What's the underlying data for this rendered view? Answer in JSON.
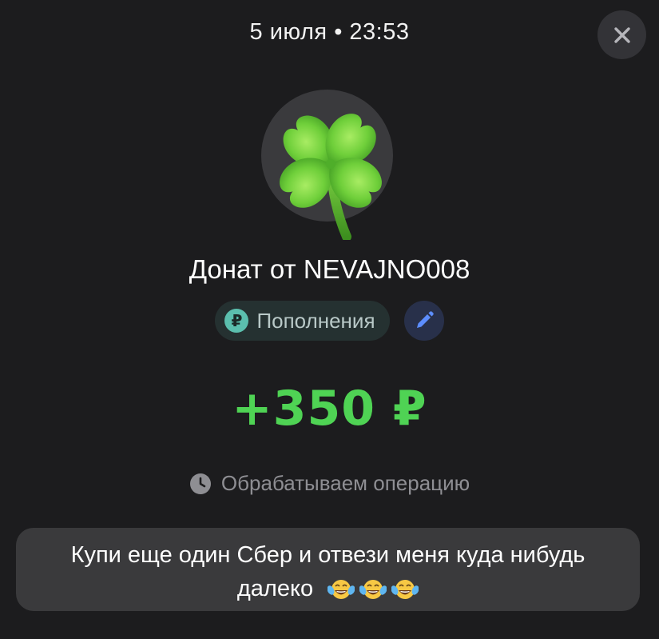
{
  "header": {
    "datetime": "5 июля • 23:53"
  },
  "donation": {
    "title": "Донат от NEVAJNO008",
    "category_label": "Пополнения",
    "category_icon": "ruble-icon",
    "amount": "+350 ₽",
    "status": "Обрабатываем операцию"
  },
  "message": {
    "line1": "Купи еще один Сбер и отвези меня куда нибудь",
    "line2": "далеко",
    "emoji": [
      "face-with-tears-of-joy-icon",
      "face-with-tears-of-joy-icon",
      "face-with-tears-of-joy-icon"
    ]
  },
  "colors": {
    "background": "#1c1c1e",
    "amount_green": "#4fd354",
    "category_pill": "#253131",
    "ruble_badge": "#5bbfae",
    "edit_blue": "#5c8dff",
    "bubble": "#3a3a3c"
  }
}
